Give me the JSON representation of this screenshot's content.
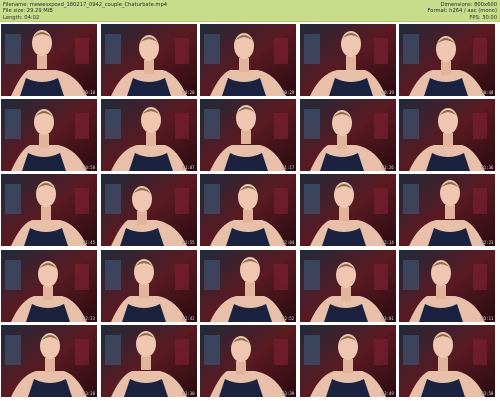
{
  "header": {
    "filename": "Filename: mewesxpoxd_180217_0942_couple_Chaturbate.mp4",
    "filesize": "File size: 29.29 MiB",
    "length": "Length: 04:02",
    "dimensions": "Dimensions: 800x600",
    "format": "Format: h264 / aac (mono)",
    "fps": "FPS: 30.00"
  },
  "colors": {
    "header_bg": "#c8dc8c",
    "thumb_bg": "#3a0f14"
  },
  "thumbnails": [
    {
      "time": "00:10"
    },
    {
      "time": "00:20"
    },
    {
      "time": "00:29"
    },
    {
      "time": "00:39"
    },
    {
      "time": "00:48"
    },
    {
      "time": "00:58"
    },
    {
      "time": "01:07"
    },
    {
      "time": "01:17"
    },
    {
      "time": "01:26"
    },
    {
      "time": "01:36"
    },
    {
      "time": "01:45"
    },
    {
      "time": "01:55"
    },
    {
      "time": "02:04"
    },
    {
      "time": "02:14"
    },
    {
      "time": "02:23"
    },
    {
      "time": "02:33"
    },
    {
      "time": "02:42"
    },
    {
      "time": "02:52"
    },
    {
      "time": "03:01"
    },
    {
      "time": "03:11"
    },
    {
      "time": "03:20"
    },
    {
      "time": "03:30"
    },
    {
      "time": "03:39"
    },
    {
      "time": "03:49"
    },
    {
      "time": "03:58"
    }
  ]
}
